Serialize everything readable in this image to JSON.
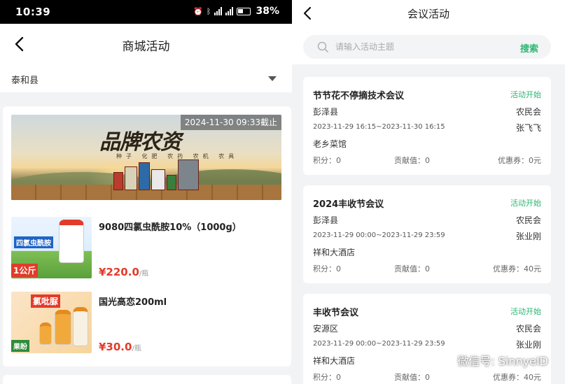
{
  "status_bar": {
    "time": "10:39",
    "battery": "38%",
    "network": "4G"
  },
  "mall": {
    "title": "商城活动",
    "region": "泰和县",
    "banner": {
      "brand": "品牌农资",
      "subtitle": "种子 化肥 农药 农机 农具",
      "deadline": "2024-11-30 09:33截止"
    },
    "products": [
      {
        "name": "9080四氯虫酰胺10%（1000g）",
        "price": "¥220.0",
        "unit": "/瓶",
        "label_top": "四氯虫酰胺",
        "label_bottom": "1公斤"
      },
      {
        "name": "国光高恋200ml",
        "price": "¥30.0",
        "unit": "/瓶",
        "label_top": "氯吡脲",
        "label_bottom": "果盼"
      }
    ]
  },
  "meetings_page": {
    "title": "会议活动",
    "search": {
      "placeholder": "请输入活动主题",
      "button": "搜索"
    },
    "meetings": [
      {
        "title": "节节花不停摘技术会议",
        "status": "活动开始",
        "region": "彭泽县",
        "org": "农民会",
        "time": "2023-11-29 16:15~2023-11-30 16:15",
        "person": "张飞飞",
        "venue": "老乡菜馆",
        "points": "积分：0",
        "contribution": "贡献值：0",
        "coupon": "优惠券：0元"
      },
      {
        "title": "2024丰收节会议",
        "status": "活动开始",
        "region": "彭泽县",
        "org": "农民会",
        "time": "2023-11-29 00:00~2023-11-29 23:59",
        "person": "张业刚",
        "venue": "祥和大酒店",
        "points": "积分：0",
        "contribution": "贡献值：0",
        "coupon": "优惠券：40元"
      },
      {
        "title": "丰收节会议",
        "status": "活动开始",
        "region": "安源区",
        "org": "农民会",
        "time": "2023-11-29 00:00~2023-11-29 23:59",
        "person": "张业刚",
        "venue": "祥和大酒店",
        "points": "积分：0",
        "contribution": "贡献值：0",
        "coupon": "优惠券：40元"
      }
    ]
  },
  "watermark": {
    "text": "微信号: SinnyeID"
  },
  "colors": {
    "accent_green": "#2bb673",
    "price_red": "#e23b2a",
    "background": "#f2f3f5"
  },
  "icons": [
    "back-arrow-icon",
    "search-icon",
    "dropdown-caret-icon",
    "wechat-icon",
    "alarm-icon",
    "bluetooth-icon",
    "signal-icon",
    "battery-icon"
  ]
}
